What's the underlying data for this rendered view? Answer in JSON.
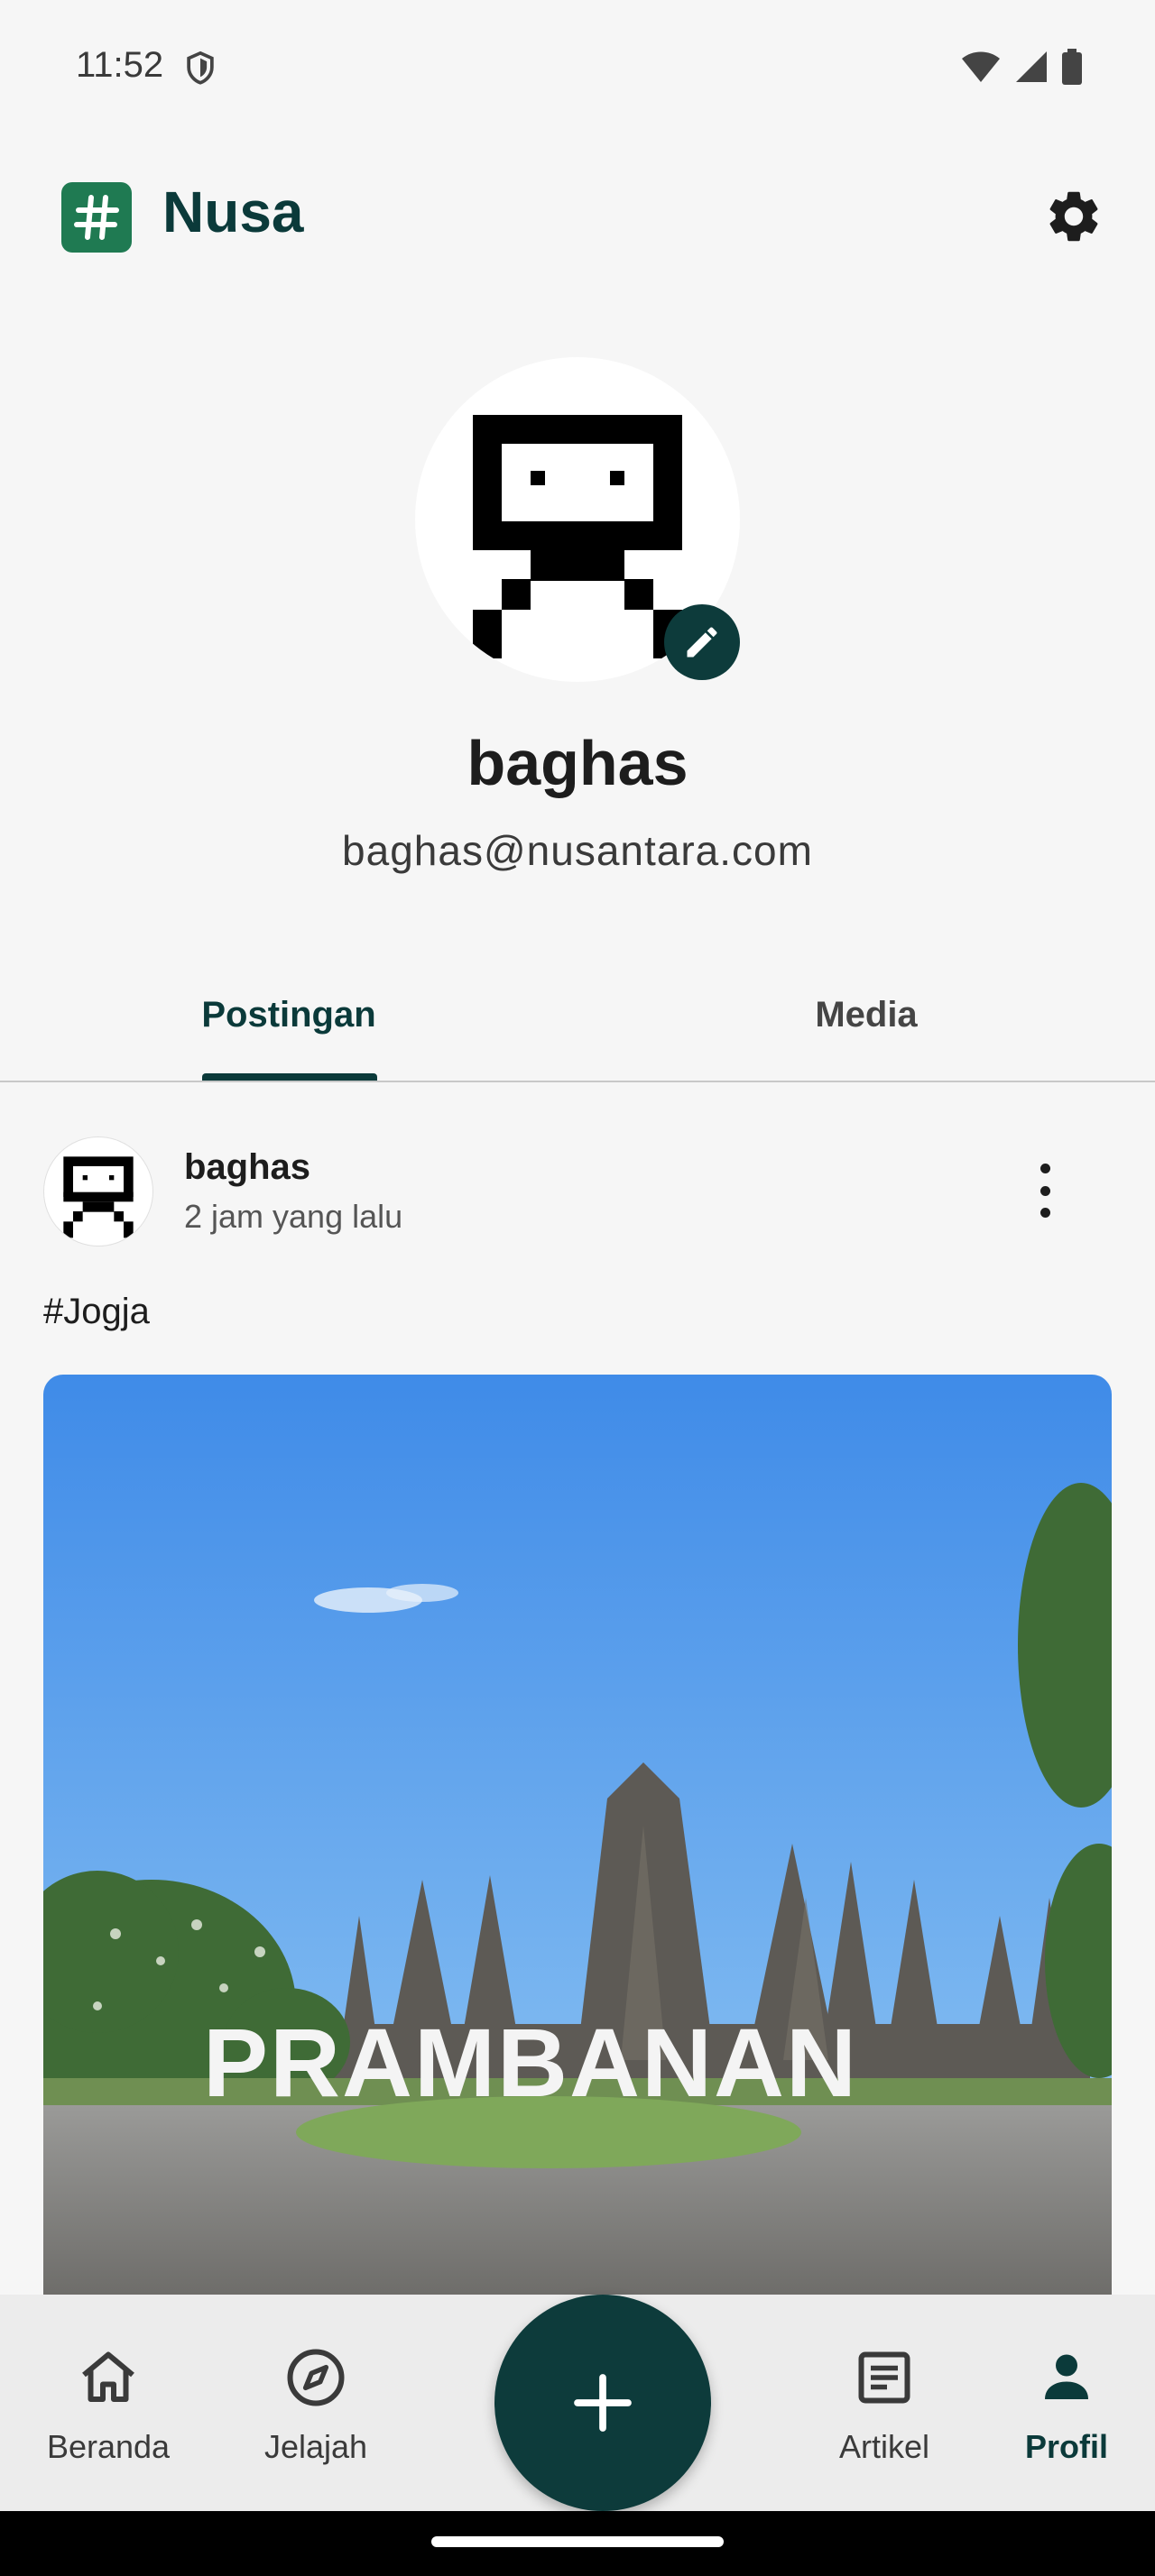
{
  "status_bar": {
    "time": "11:52"
  },
  "app": {
    "title": "Nusa",
    "logo_glyph": "#",
    "logo_color": "#1f7a52",
    "accent": "#0b3a3a"
  },
  "profile": {
    "username": "baghas",
    "email": "baghas@nusantara.com"
  },
  "tabs": [
    {
      "label": "Postingan",
      "active": true
    },
    {
      "label": "Media",
      "active": false
    }
  ],
  "post": {
    "author": "baghas",
    "time": "2 jam yang lalu",
    "text": "#Jogja",
    "image_sign": "PRAMBANAN"
  },
  "nav": [
    {
      "label": "Beranda",
      "icon": "home-icon"
    },
    {
      "label": "Jelajah",
      "icon": "compass-icon"
    },
    {
      "label": "Artikel",
      "icon": "article-icon"
    },
    {
      "label": "Profil",
      "icon": "person-icon",
      "active": true
    }
  ],
  "fab": {
    "icon": "plus-icon"
  }
}
